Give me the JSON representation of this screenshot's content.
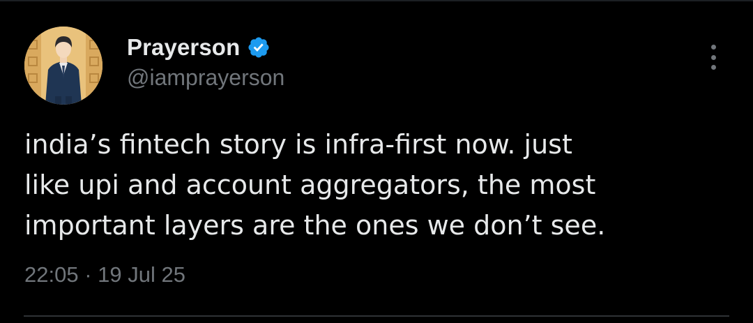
{
  "tweet": {
    "author": {
      "display_name": "Prayerson",
      "handle": "@iamprayerson",
      "verified": true,
      "verified_color": "#1d9bf0",
      "avatar_icon": "avatar-illustration"
    },
    "text_lines": [
      "india’s fintech story is infra-first now. just",
      "like upi and account aggregators, the most",
      "important layers are the ones we don’t see."
    ],
    "time": "22:05",
    "separator": "·",
    "date": "19 Jul 25",
    "more_icon": "more-options-icon"
  },
  "colors": {
    "background": "#000000",
    "text_primary": "#e7e9ea",
    "text_secondary": "#71767b",
    "divider": "#2f3336"
  }
}
